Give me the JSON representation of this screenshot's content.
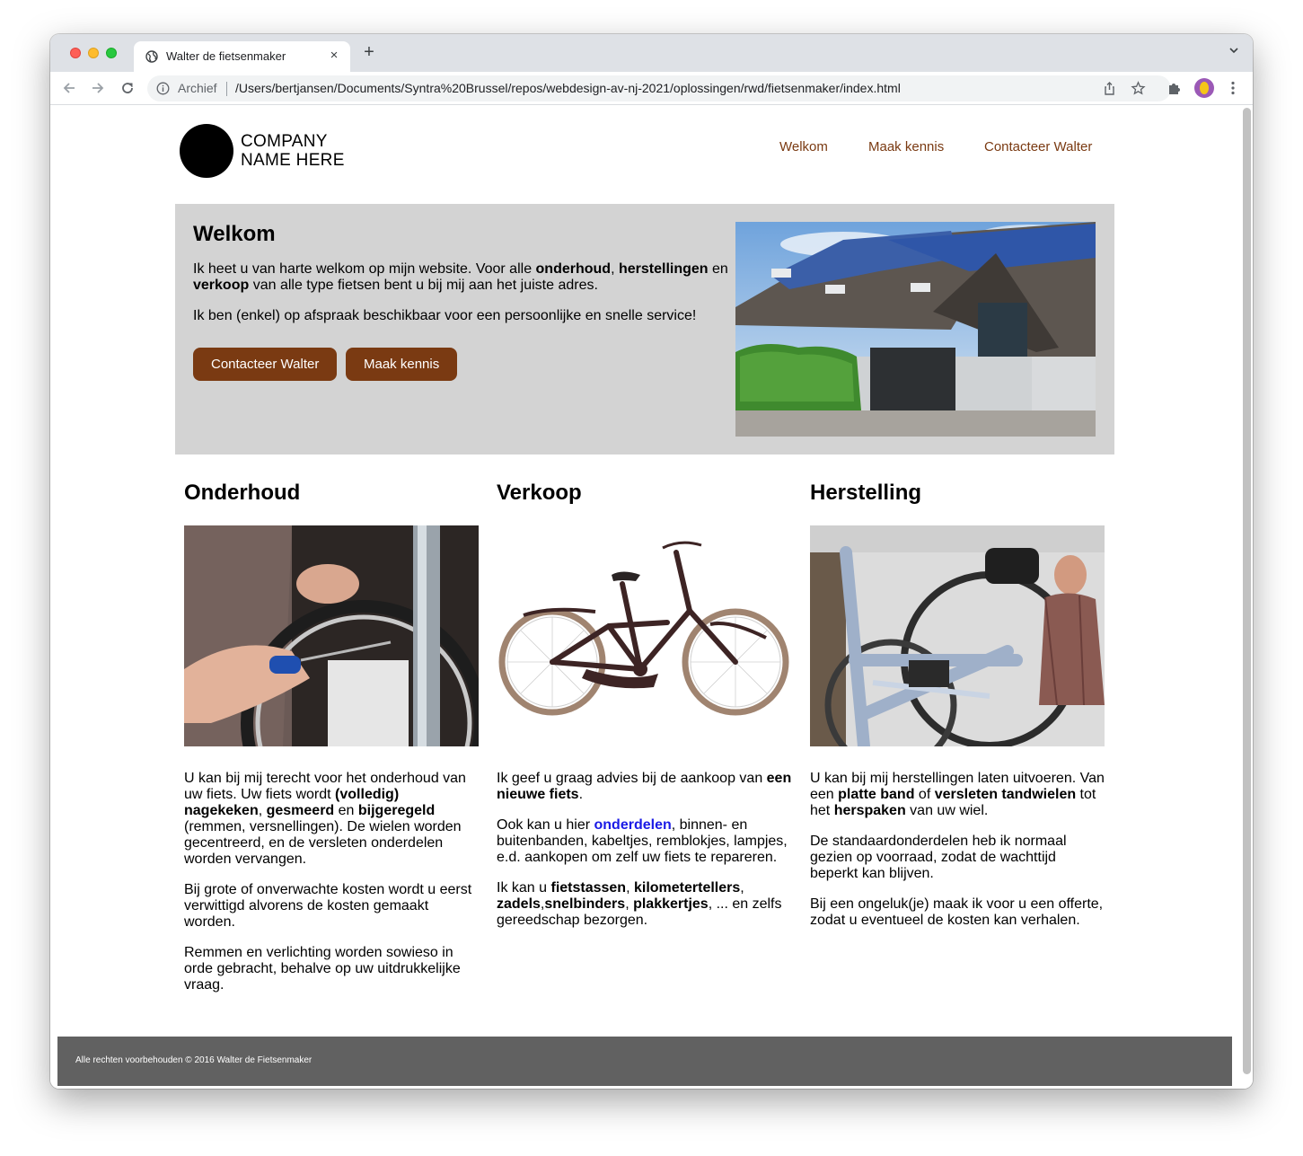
{
  "browser": {
    "tab_title": "Walter de fietsenmaker",
    "close_symbol": "×",
    "new_tab_symbol": "+",
    "security_label": "Archief",
    "url": "/Users/bertjansen/Documents/Syntra%20Brussel/repos/webdesign-av-nj-2021/oplossingen/rwd/fietsenmaker/index.html"
  },
  "header": {
    "logo_line1": "COMPANY",
    "logo_line2": "NAME HERE",
    "nav": [
      "Welkom",
      "Maak kennis",
      "Contacteer Walter"
    ]
  },
  "hero": {
    "title": "Welkom",
    "p1_a": "Ik heet u van harte welkom op mijn website. Voor alle ",
    "p1_b": "onderhoud",
    "p1_c": ", ",
    "p1_d": "herstellingen",
    "p1_e": " en ",
    "p1_f": "verkoop",
    "p1_g": " van alle type fietsen bent u bij mij aan het juiste adres.",
    "p2": "Ik ben (enkel) op afspraak beschikbaar voor een persoonlijke en snelle service!",
    "button_contact": "Contacteer Walter",
    "button_meet": "Maak kennis"
  },
  "onderhoud": {
    "title": "Onderhoud",
    "p1_a": "U kan bij mij terecht voor het onderhoud van uw fiets. Uw fiets wordt ",
    "p1_b": "(volledig) nagekeken",
    "p1_c": ", ",
    "p1_d": "gesmeerd",
    "p1_e": " en ",
    "p1_f": "bijgeregeld",
    "p1_g": " (remmen, versnellingen). De wielen worden gecentreerd, en de versleten onderdelen worden vervangen.",
    "p2": "Bij grote of onverwachte kosten wordt u eerst verwittigd alvorens de kosten gemaakt worden.",
    "p3": "Remmen en verlichting worden sowieso in orde gebracht, behalve op uw uitdrukkelijke vraag."
  },
  "verkoop": {
    "title": "Verkoop",
    "p1_a": "Ik geef u graag advies bij de aankoop van ",
    "p1_b": "een nieuwe fiets",
    "p1_c": ".",
    "p2_a": "Ook kan u hier ",
    "p2_link": "onderdelen",
    "p2_b": ", binnen- en buitenbanden, kabeltjes, remblokjes, lampjes, e.d. aankopen om zelf uw fiets te repareren.",
    "p3_a": "Ik kan u ",
    "p3_b": "fietstassen",
    "p3_c": ", ",
    "p3_d": "kilometertellers",
    "p3_e": ", ",
    "p3_f": "zadels",
    "p3_g": ",",
    "p3_h": "snelbinders",
    "p3_i": ", ",
    "p3_j": "plakkertjes",
    "p3_k": ", ... en zelfs gereedschap bezorgen."
  },
  "herstelling": {
    "title": "Herstelling",
    "p1_a": "U kan bij mij herstellingen laten uitvoeren. Van een ",
    "p1_b": "platte band",
    "p1_c": " of ",
    "p1_d": "versleten tandwielen",
    "p1_e": " tot het ",
    "p1_f": "herspaken",
    "p1_g": " van uw wiel.",
    "p2": "De standaardonderdelen heb ik normaal gezien op voorraad, zodat de wachttijd beperkt kan blijven.",
    "p3": "Bij een ongeluk(je) maak ik voor u een offerte, zodat u eventueel de kosten kan verhalen."
  },
  "footer": {
    "text": "Alle rechten voorbehouden © 2016 Walter de Fietsenmaker"
  },
  "colors": {
    "accent": "#7a3a12",
    "hero_bg": "#d3d3d3",
    "footer_bg": "#616161",
    "link": "#1a1ae6"
  }
}
